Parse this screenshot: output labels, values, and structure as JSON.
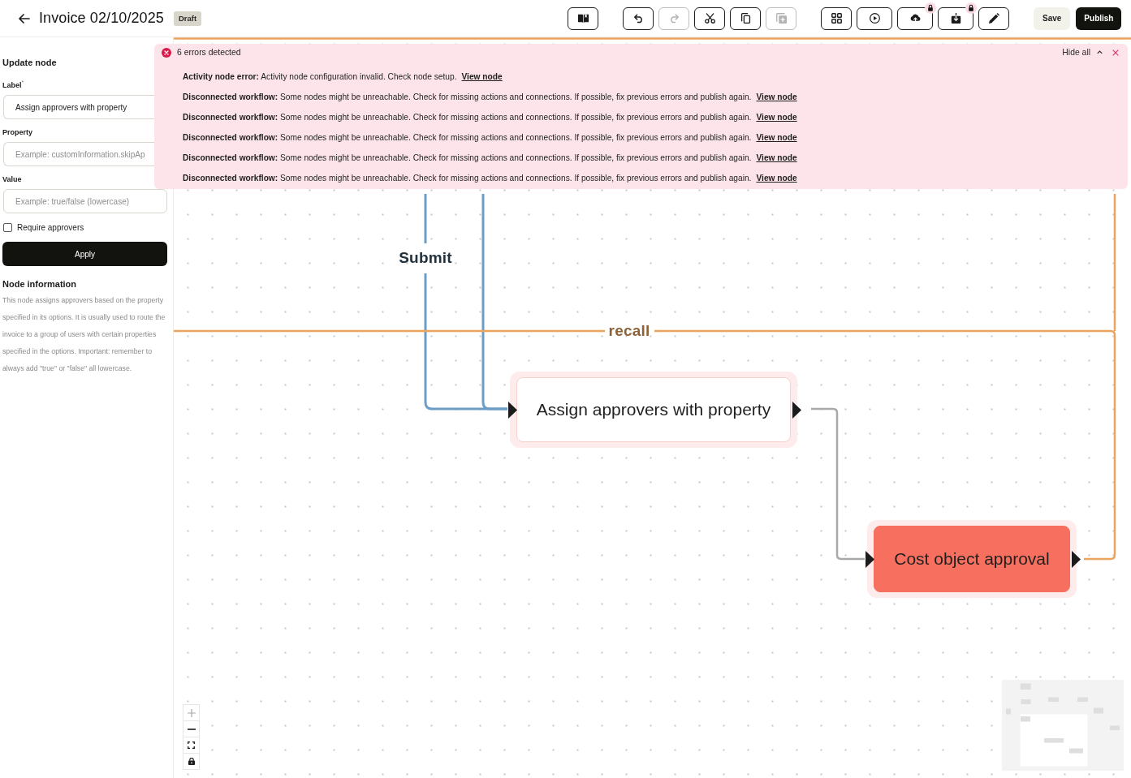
{
  "header": {
    "title": "Invoice 02/10/2025",
    "badge": "Draft"
  },
  "toolbar": {
    "groups": [
      {
        "buttons": [
          {
            "disabled": false,
            "locked": false
          }
        ]
      },
      {
        "buttons": [
          {
            "disabled": false,
            "locked": false
          },
          {
            "disabled": true,
            "locked": false
          },
          {
            "disabled": false,
            "locked": false
          },
          {
            "disabled": false,
            "locked": false
          },
          {
            "disabled": true,
            "locked": false
          }
        ]
      },
      {
        "buttons": [
          {
            "disabled": false,
            "locked": false
          },
          {
            "disabled": false,
            "locked": false
          },
          {
            "disabled": false,
            "locked": true
          },
          {
            "disabled": false,
            "locked": true
          },
          {
            "disabled": false,
            "locked": false
          }
        ]
      }
    ],
    "actions": [
      {
        "label": "Save",
        "kind": "secondary"
      },
      {
        "label": "Publish",
        "kind": "primary"
      }
    ]
  },
  "panel": {
    "title": "Update node",
    "fields": [
      {
        "label": "Label$^{*}$",
        "value": "Assign approvers with property"
      },
      {
        "label": "Property",
        "placeholder": "Example: customInformation.skipAp"
      },
      {
        "label": "Value",
        "placeholder": "Example: true/false (lowercase)"
      }
    ],
    "checkbox": {
      "label": "Require approvers",
      "checked": false
    },
    "apply": "Apply",
    "info": {
      "title": "Node information",
      "text": "This node assigns approvers based on the property specified in its options. It is usually used to route the invoice to a group of users with certain properties specified in the options. Important: remember to always add \"true\" or \"false\" all lowercase."
    }
  },
  "canvas": {
    "edges": [
      {
        "color": "#eba45e"
      },
      {
        "label": "Submit",
        "color": "#6c9dc6"
      },
      {
        "color": "#6c9dc6"
      },
      {
        "label": "recall",
        "color": "#eba45e"
      },
      {
        "color": "#a9a9a9"
      }
    ],
    "nodes": [
      {
        "label": "Assign approvers with property",
        "color": "#ffffff",
        "error": true
      },
      {
        "label": "Cost object approval",
        "color": "#f7705f",
        "error": true
      }
    ],
    "zoom_controls": [
      {
        "disabled": true
      },
      {
        "disabled": false
      },
      {
        "disabled": false
      },
      {
        "disabled": false
      }
    ]
  },
  "errors": {
    "summary": "6 errors detected",
    "toggle": "Hide all",
    "expanded": true,
    "items": [
      {
        "text": "**Activity node error:** Activity node configuration invalid. Check node setup.",
        "link": "View node"
      },
      {
        "text": "**Disconnected workflow:** Some nodes might be unreachable. Check for missing actions and connections. If possible, fix previous errors and publish again.",
        "link": "View node"
      },
      {
        "text": "**Disconnected workflow:** Some nodes might be unreachable. Check for missing actions and connections. If possible, fix previous errors and publish again.",
        "link": "View node"
      },
      {
        "text": "**Disconnected workflow:** Some nodes might be unreachable. Check for missing actions and connections. If possible, fix previous errors and publish again.",
        "link": "View node"
      },
      {
        "text": "**Disconnected workflow:** Some nodes might be unreachable. Check for missing actions and connections. If possible, fix previous errors and publish again.",
        "link": "View node"
      },
      {
        "text": "**Disconnected workflow:** Some nodes might be unreachable. Check for missing actions and connections. If possible, fix previous errors and publish again.",
        "link": "View node"
      }
    ]
  }
}
